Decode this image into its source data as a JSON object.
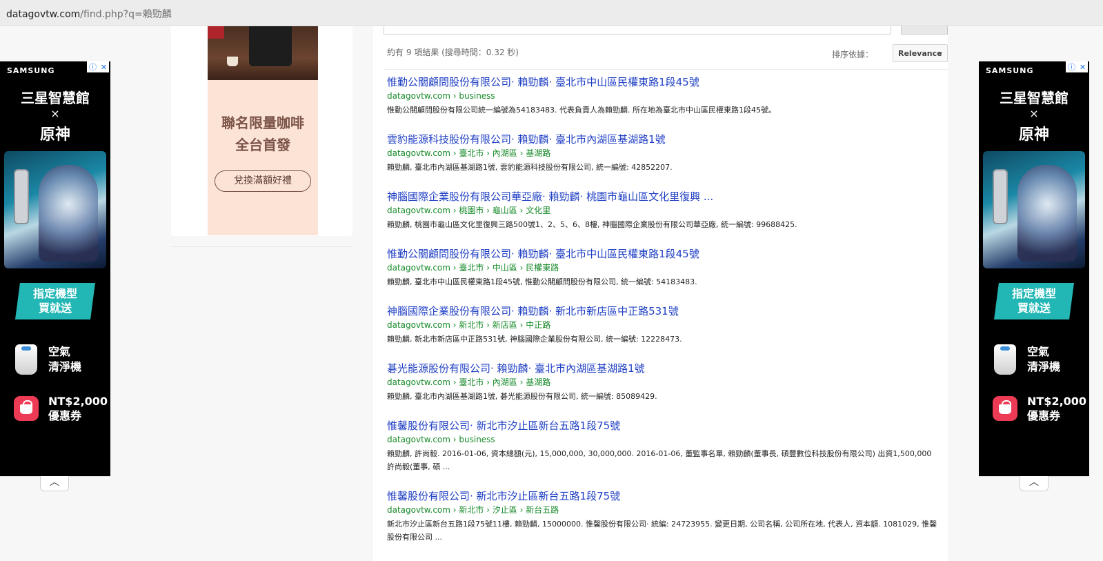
{
  "browser": {
    "url_host": "datagovtw.com",
    "url_path": "/find.php?q=賴勁麟"
  },
  "side_ad": {
    "brand": "SAMSUNG",
    "title": "三星智慧館",
    "cross": "×",
    "game": "原神",
    "promo_line1": "指定機型",
    "promo_line2": "買就送",
    "item1_line1": "空氣",
    "item1_line2": "清淨機",
    "item2_line1": "NT$2,000",
    "item2_line2": "優惠券",
    "collapse_icon": "chevron-up-icon",
    "adchoice_icon": "info-icon",
    "close_icon": "close-icon"
  },
  "center_ad": {
    "headline_line1": "聯名限量咖啡",
    "headline_line2": "全台首發",
    "cta": "兌換滿額好禮"
  },
  "search": {
    "stats": "約有 9 項結果 (搜尋時間：0.32 秒)",
    "sort_label": "排序依據：",
    "sort_value": "Relevance"
  },
  "results": [
    {
      "title": "惟勤公關顧問股份有限公司· 賴勁麟· 臺北市中山區民權東路1段45號",
      "url": "datagovtw.com › business",
      "snippet": "惟勤公關顧問股份有限公司統一編號為54183483. 代表負責人為賴勁麟. 所在地為臺北市中山區民權東路1段45號。"
    },
    {
      "title": "雲豹能源科技股份有限公司· 賴勁麟· 臺北市內湖區基湖路1號",
      "url": "datagovtw.com › 臺北市 › 內湖區 › 基湖路",
      "snippet": "賴勁麟, 臺北市內湖區基湖路1號, 雲豹能源科技股份有限公司, 統一編號: 42852207."
    },
    {
      "title": "神腦國際企業股份有限公司華亞廠· 賴勁麟· 桃園市龜山區文化里復興 ...",
      "url": "datagovtw.com › 桃園市 › 龜山區 › 文化里",
      "snippet": "賴勁麟, 桃園市龜山區文化里復興三路500號1、2、5、6、8樓, 神腦國際企業股份有限公司華亞廠, 統一編號: 99688425."
    },
    {
      "title": "惟勤公關顧問股份有限公司· 賴勁麟· 臺北市中山區民權東路1段45號",
      "url": "datagovtw.com › 臺北市 › 中山區 › 民權東路",
      "snippet": "賴勁麟, 臺北市中山區民權東路1段45號, 惟勤公關顧問股份有限公司, 統一編號: 54183483."
    },
    {
      "title": "神腦國際企業股份有限公司· 賴勁麟· 新北市新店區中正路531號",
      "url": "datagovtw.com › 新北市 › 新店區 › 中正路",
      "snippet": "賴勁麟, 新北市新店區中正路531號, 神腦國際企業股份有限公司, 統一編號: 12228473."
    },
    {
      "title": "碁光能源股份有限公司· 賴勁麟· 臺北市內湖區基湖路1號",
      "url": "datagovtw.com › 臺北市 › 內湖區 › 基湖路",
      "snippet": "賴勁麟, 臺北市內湖區基湖路1號, 碁光能源股份有限公司, 統一編號: 85089429."
    },
    {
      "title": "惟馨股份有限公司· 新北市汐止區新台五路1段75號",
      "url": "datagovtw.com › business",
      "snippet": "賴勁麟, 許尚毅. 2016-01-06, 資本總額(元), 15,000,000, 30,000,000. 2016-01-06, 董監事名單, 賴勁麟(董事長, 碩豐數位科技股份有限公司) 出資1,500,000 許尚毅(董事, 碩 ..."
    },
    {
      "title": "惟馨股份有限公司· 新北市汐止區新台五路1段75號",
      "url": "datagovtw.com › 新北市 › 汐止區 › 新台五路",
      "snippet": "新北市汐止區新台五路1段75號11樓, 賴勁麟, 15000000. 惟馨股份有限公司· 統編: 24723955. 變更日期, 公司名稱, 公司所在地, 代表人, 資本額. 1081029, 惟馨股份有限公司 ..."
    }
  ]
}
